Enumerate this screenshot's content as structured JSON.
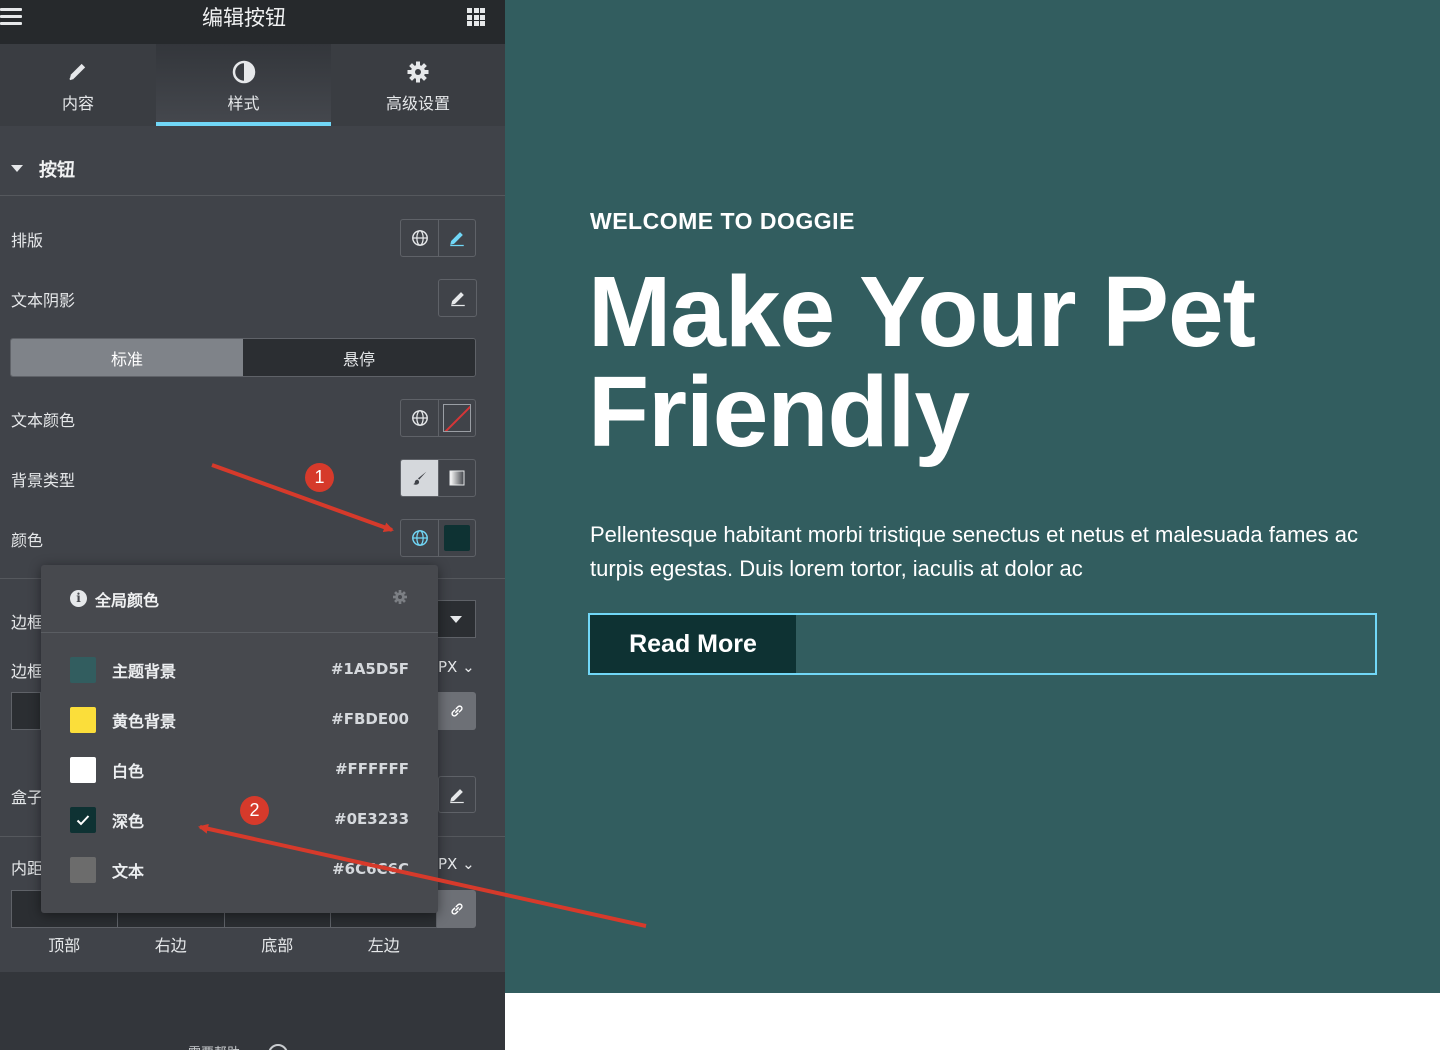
{
  "panel": {
    "title": "编辑按钮",
    "tabs": [
      {
        "label": "内容"
      },
      {
        "label": "样式"
      },
      {
        "label": "高级设置"
      }
    ],
    "section_title": "按钮",
    "controls": {
      "typography": "排版",
      "text_shadow": "文本阴影",
      "state_normal": "标准",
      "state_hover": "悬停",
      "text_color": "文本颜色",
      "background_type": "背景类型",
      "color": "颜色",
      "border_type_partial": "边框",
      "border_width_partial": "边框",
      "box_shadow_partial": "盒子",
      "padding_partial": "内距",
      "unit": "PX"
    },
    "dimension_labels": [
      "顶部",
      "右边",
      "底部",
      "左边"
    ],
    "footer_peek": "需要帮助"
  },
  "popover": {
    "title": "全局颜色",
    "colors": [
      {
        "name": "主题背景",
        "hex": "#1A5D5F",
        "swatch": "#325d5f"
      },
      {
        "name": "黄色背景",
        "hex": "#FBDE00",
        "swatch": "#fbde3a"
      },
      {
        "name": "白色",
        "hex": "#FFFFFF",
        "swatch": "#ffffff"
      },
      {
        "name": "深色",
        "hex": "#0E3233",
        "swatch": "#0e3233",
        "selected": true
      },
      {
        "name": "文本",
        "hex": "#6C6C6C",
        "swatch": "#6c6c6c"
      }
    ]
  },
  "preview": {
    "eyebrow": "WELCOME TO DOGGIE",
    "headline": "Make Your Pet Friendly",
    "body": "Pellentesque habitant morbi tristique senectus et netus et malesuada fames ac turpis egestas. Duis lorem tortor, iaculis at dolor ac",
    "button_label": "Read More"
  },
  "annotations": {
    "badge_1": "1",
    "badge_2": "2"
  },
  "colors": {
    "panel_bg": "#404349",
    "topbar_bg": "#26292c",
    "accent": "#71d7f7",
    "preview_bg": "#325d5f",
    "annotation_red": "#d63a2b"
  }
}
